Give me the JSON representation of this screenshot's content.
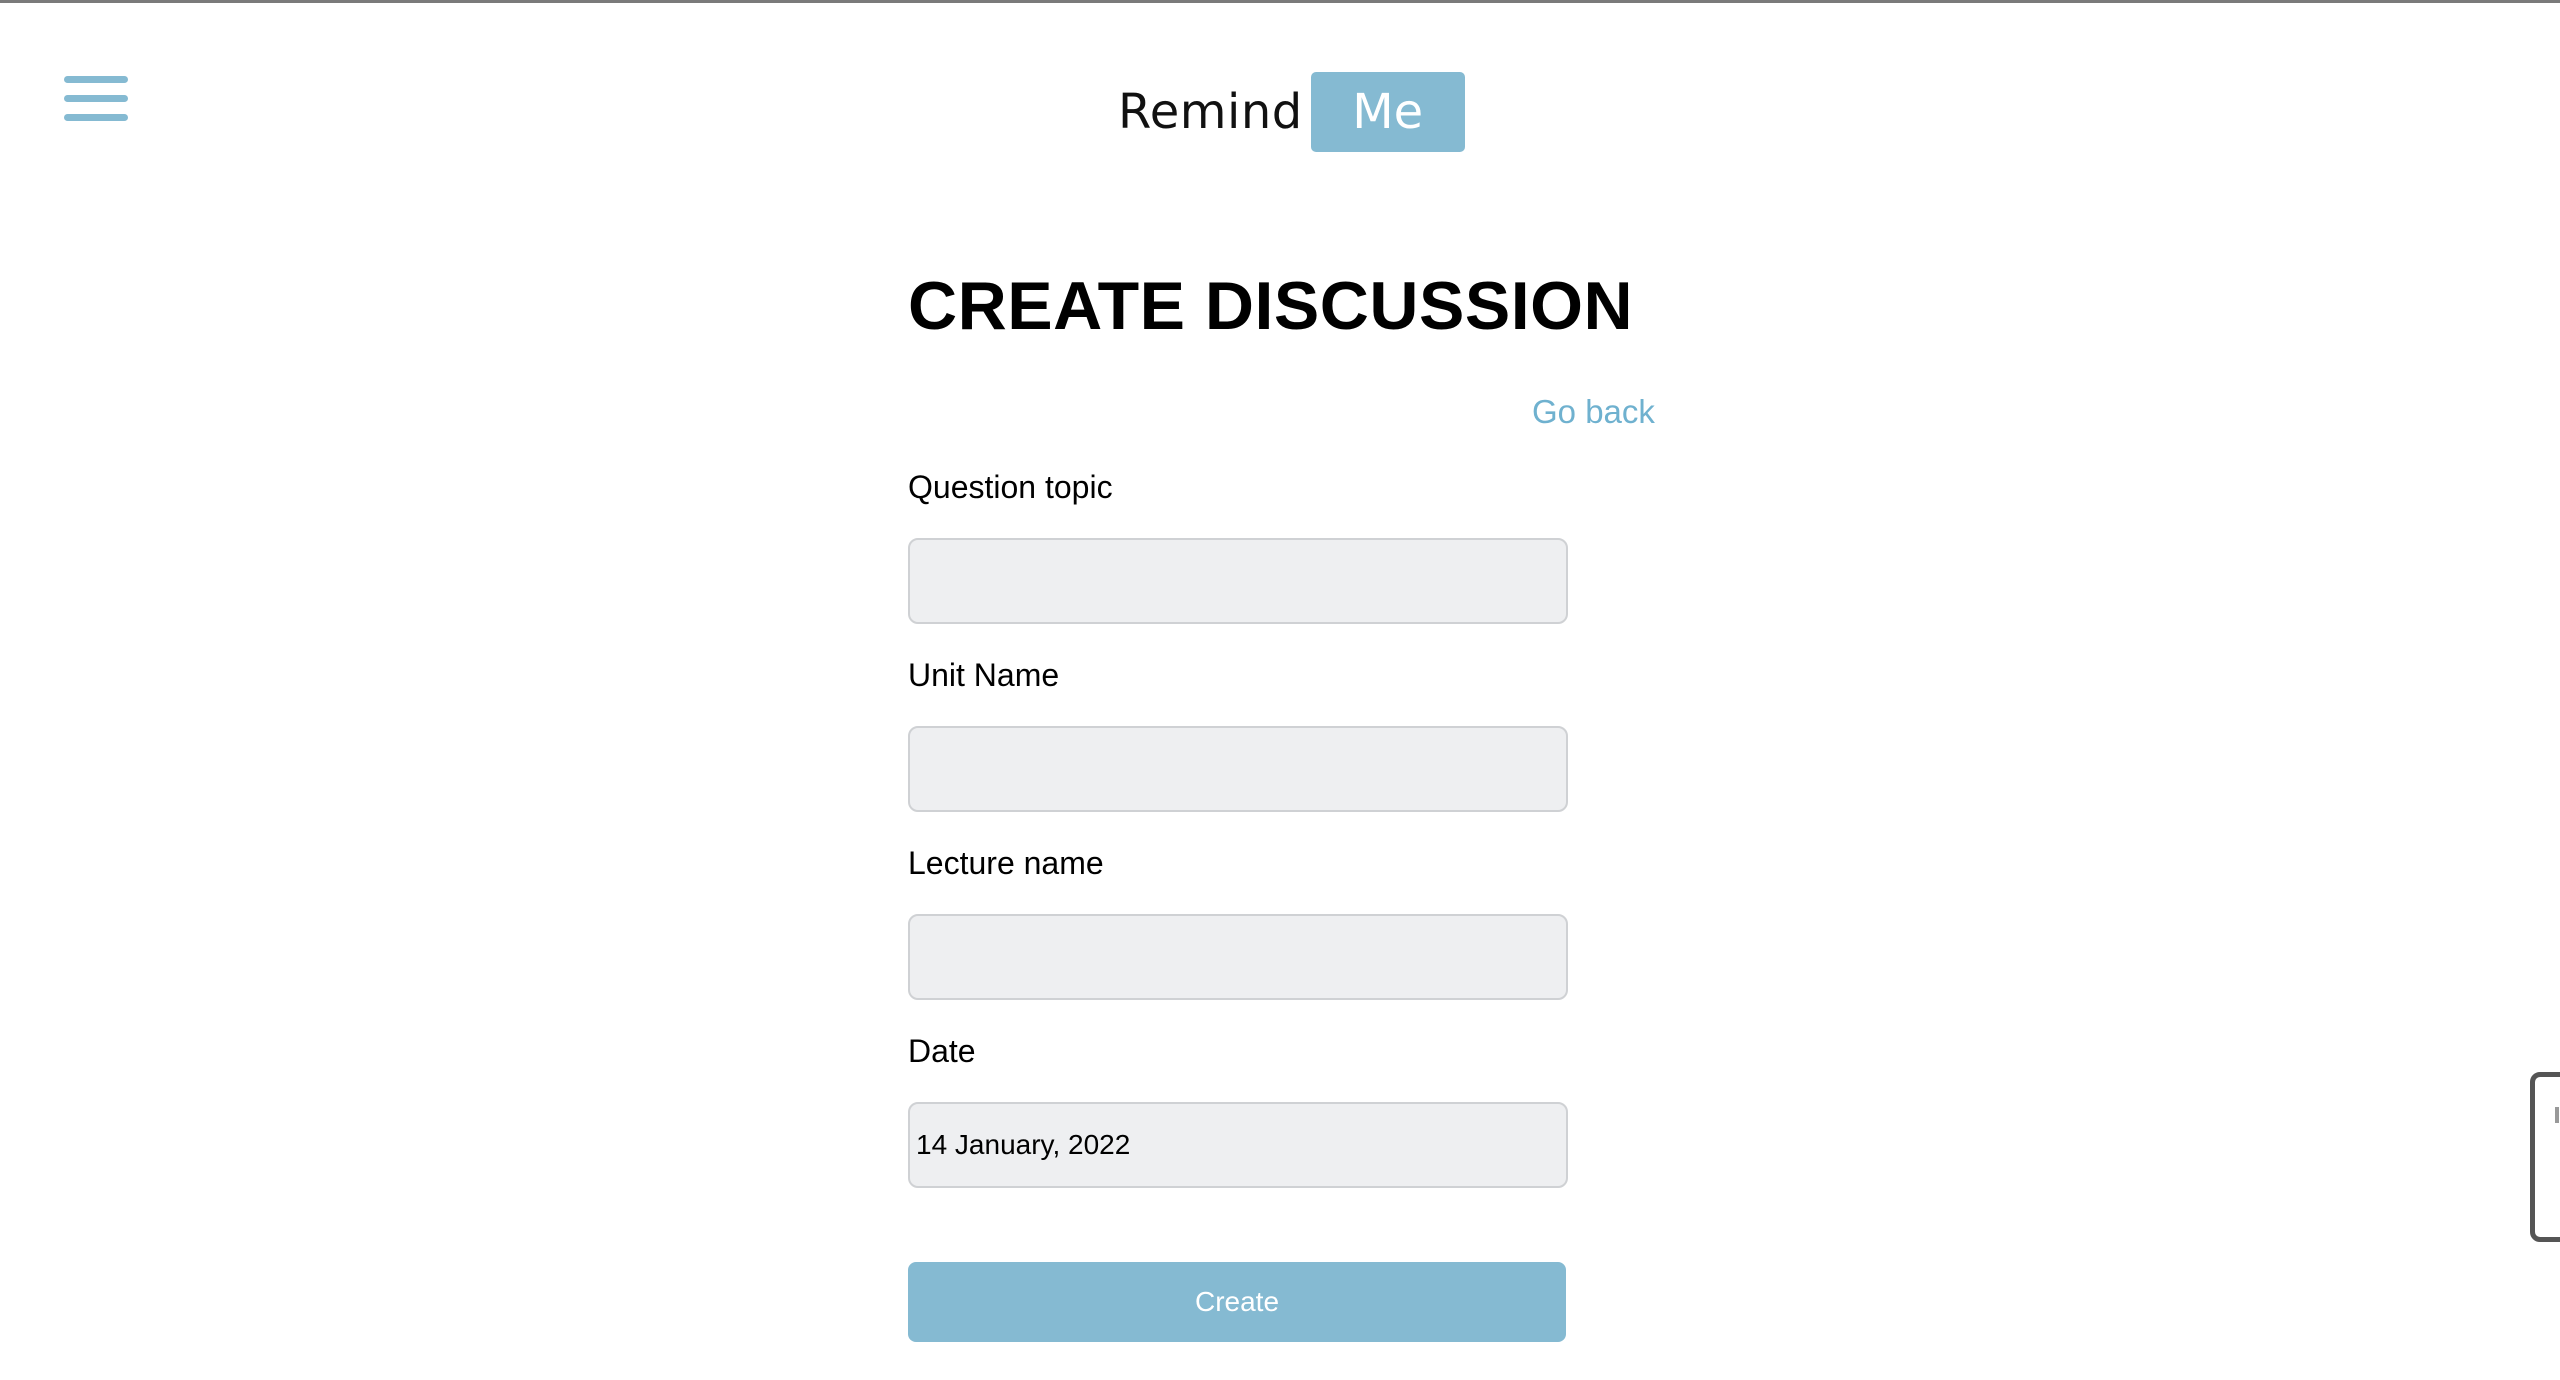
{
  "header": {
    "menu_icon": "hamburger-menu-icon",
    "logo": {
      "part1": "Remind",
      "part2": "Me"
    }
  },
  "page": {
    "title": "CREATE DISCUSSION",
    "go_back": "Go back"
  },
  "form": {
    "fields": [
      {
        "label": "Question topic",
        "value": "",
        "placeholder": ""
      },
      {
        "label": "Unit Name",
        "value": "",
        "placeholder": ""
      },
      {
        "label": "Lecture name",
        "value": "",
        "placeholder": ""
      },
      {
        "label": "Date",
        "value": "14 January, 2022",
        "placeholder": ""
      }
    ],
    "submit_label": "Create"
  },
  "colors": {
    "accent": "#85bad2",
    "link": "#6fb1cf",
    "input_bg": "#eeeff1"
  }
}
